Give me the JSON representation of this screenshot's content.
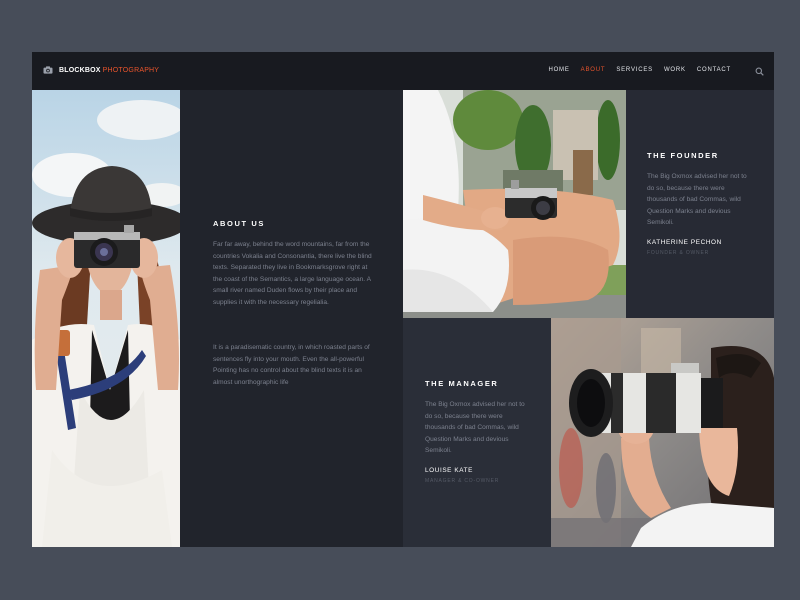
{
  "brand": {
    "name": "BLOCKBOX",
    "accent": "PHOTOGRAPHY",
    "icon": "camera-icon",
    "accent_color": "#e8542c"
  },
  "nav": {
    "items": [
      {
        "label": "HOME",
        "active": false
      },
      {
        "label": "ABOUT",
        "active": true
      },
      {
        "label": "SERVICES",
        "active": false
      },
      {
        "label": "WORK",
        "active": false
      },
      {
        "label": "CONTACT",
        "active": false
      }
    ],
    "search_icon": "search-icon"
  },
  "about": {
    "title": "ABOUT US",
    "paragraphs": [
      "Far far away, behind the word mountains, far from the countries Vokalia and Consonantia, there live the blind texts. Separated they live in Bookmarksgrove right at the coast of the Semantics, a large language ocean. A small river named Duden flows by their place and supplies it with the necessary regelialia.",
      "It is a paradisematic country, in which roasted parts of sentences fly into your mouth. Even the all-powerful Pointing has no control about the blind texts it is an almost unorthographic life"
    ]
  },
  "founder": {
    "title": "THE FOUNDER",
    "text": "The Big Oxmox advised her not to do so, because there were thousands of bad Commas, wild Question Marks and devious Semikoli.",
    "name": "KATHERINE PECHON",
    "role": "FOUNDER & OWNER"
  },
  "manager": {
    "title": "THE MANAGER",
    "text": "The Big Oxmox advised her not to do so, because there were thousands of bad Commas, wild Question Marks and devious Semikoli.",
    "name": "LOUISE KATE",
    "role": "MANAGER & CO-OWNER"
  }
}
